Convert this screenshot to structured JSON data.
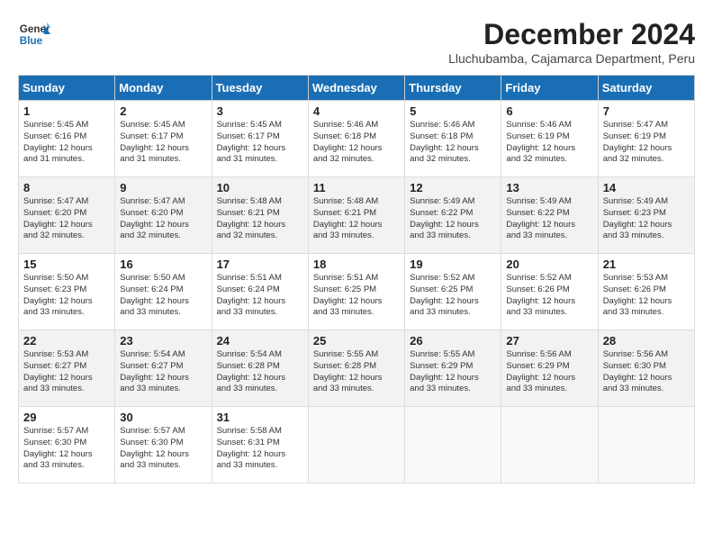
{
  "logo": {
    "line1": "General",
    "line2": "Blue"
  },
  "title": "December 2024",
  "location": "Lluchubamba, Cajamarca Department, Peru",
  "weekdays": [
    "Sunday",
    "Monday",
    "Tuesday",
    "Wednesday",
    "Thursday",
    "Friday",
    "Saturday"
  ],
  "weeks": [
    [
      {
        "day": "1",
        "info": "Sunrise: 5:45 AM\nSunset: 6:16 PM\nDaylight: 12 hours\nand 31 minutes."
      },
      {
        "day": "2",
        "info": "Sunrise: 5:45 AM\nSunset: 6:17 PM\nDaylight: 12 hours\nand 31 minutes."
      },
      {
        "day": "3",
        "info": "Sunrise: 5:45 AM\nSunset: 6:17 PM\nDaylight: 12 hours\nand 31 minutes."
      },
      {
        "day": "4",
        "info": "Sunrise: 5:46 AM\nSunset: 6:18 PM\nDaylight: 12 hours\nand 32 minutes."
      },
      {
        "day": "5",
        "info": "Sunrise: 5:46 AM\nSunset: 6:18 PM\nDaylight: 12 hours\nand 32 minutes."
      },
      {
        "day": "6",
        "info": "Sunrise: 5:46 AM\nSunset: 6:19 PM\nDaylight: 12 hours\nand 32 minutes."
      },
      {
        "day": "7",
        "info": "Sunrise: 5:47 AM\nSunset: 6:19 PM\nDaylight: 12 hours\nand 32 minutes."
      }
    ],
    [
      {
        "day": "8",
        "info": "Sunrise: 5:47 AM\nSunset: 6:20 PM\nDaylight: 12 hours\nand 32 minutes."
      },
      {
        "day": "9",
        "info": "Sunrise: 5:47 AM\nSunset: 6:20 PM\nDaylight: 12 hours\nand 32 minutes."
      },
      {
        "day": "10",
        "info": "Sunrise: 5:48 AM\nSunset: 6:21 PM\nDaylight: 12 hours\nand 32 minutes."
      },
      {
        "day": "11",
        "info": "Sunrise: 5:48 AM\nSunset: 6:21 PM\nDaylight: 12 hours\nand 33 minutes."
      },
      {
        "day": "12",
        "info": "Sunrise: 5:49 AM\nSunset: 6:22 PM\nDaylight: 12 hours\nand 33 minutes."
      },
      {
        "day": "13",
        "info": "Sunrise: 5:49 AM\nSunset: 6:22 PM\nDaylight: 12 hours\nand 33 minutes."
      },
      {
        "day": "14",
        "info": "Sunrise: 5:49 AM\nSunset: 6:23 PM\nDaylight: 12 hours\nand 33 minutes."
      }
    ],
    [
      {
        "day": "15",
        "info": "Sunrise: 5:50 AM\nSunset: 6:23 PM\nDaylight: 12 hours\nand 33 minutes."
      },
      {
        "day": "16",
        "info": "Sunrise: 5:50 AM\nSunset: 6:24 PM\nDaylight: 12 hours\nand 33 minutes."
      },
      {
        "day": "17",
        "info": "Sunrise: 5:51 AM\nSunset: 6:24 PM\nDaylight: 12 hours\nand 33 minutes."
      },
      {
        "day": "18",
        "info": "Sunrise: 5:51 AM\nSunset: 6:25 PM\nDaylight: 12 hours\nand 33 minutes."
      },
      {
        "day": "19",
        "info": "Sunrise: 5:52 AM\nSunset: 6:25 PM\nDaylight: 12 hours\nand 33 minutes."
      },
      {
        "day": "20",
        "info": "Sunrise: 5:52 AM\nSunset: 6:26 PM\nDaylight: 12 hours\nand 33 minutes."
      },
      {
        "day": "21",
        "info": "Sunrise: 5:53 AM\nSunset: 6:26 PM\nDaylight: 12 hours\nand 33 minutes."
      }
    ],
    [
      {
        "day": "22",
        "info": "Sunrise: 5:53 AM\nSunset: 6:27 PM\nDaylight: 12 hours\nand 33 minutes."
      },
      {
        "day": "23",
        "info": "Sunrise: 5:54 AM\nSunset: 6:27 PM\nDaylight: 12 hours\nand 33 minutes."
      },
      {
        "day": "24",
        "info": "Sunrise: 5:54 AM\nSunset: 6:28 PM\nDaylight: 12 hours\nand 33 minutes."
      },
      {
        "day": "25",
        "info": "Sunrise: 5:55 AM\nSunset: 6:28 PM\nDaylight: 12 hours\nand 33 minutes."
      },
      {
        "day": "26",
        "info": "Sunrise: 5:55 AM\nSunset: 6:29 PM\nDaylight: 12 hours\nand 33 minutes."
      },
      {
        "day": "27",
        "info": "Sunrise: 5:56 AM\nSunset: 6:29 PM\nDaylight: 12 hours\nand 33 minutes."
      },
      {
        "day": "28",
        "info": "Sunrise: 5:56 AM\nSunset: 6:30 PM\nDaylight: 12 hours\nand 33 minutes."
      }
    ],
    [
      {
        "day": "29",
        "info": "Sunrise: 5:57 AM\nSunset: 6:30 PM\nDaylight: 12 hours\nand 33 minutes."
      },
      {
        "day": "30",
        "info": "Sunrise: 5:57 AM\nSunset: 6:30 PM\nDaylight: 12 hours\nand 33 minutes."
      },
      {
        "day": "31",
        "info": "Sunrise: 5:58 AM\nSunset: 6:31 PM\nDaylight: 12 hours\nand 33 minutes."
      },
      {
        "day": "",
        "info": ""
      },
      {
        "day": "",
        "info": ""
      },
      {
        "day": "",
        "info": ""
      },
      {
        "day": "",
        "info": ""
      }
    ]
  ]
}
